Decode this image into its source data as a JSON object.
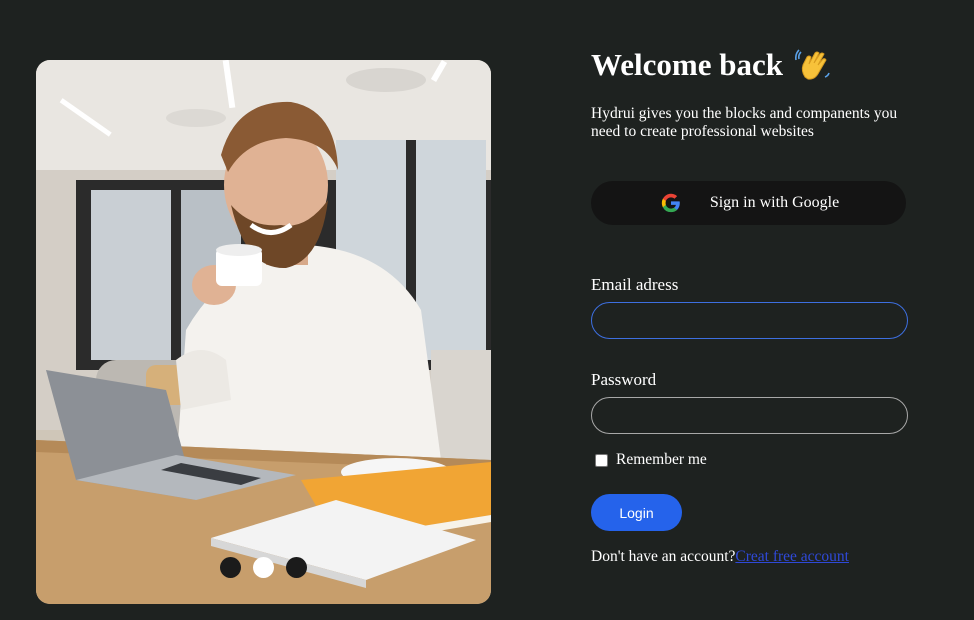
{
  "login": {
    "title": "Welcome back",
    "title_emoji_icon": "waving-hand-icon",
    "subtitle": "Hydrui gives you the blocks and companents you need to create professional websites",
    "google_button": {
      "label": "Sign in with Google",
      "icon": "google-logo-icon"
    },
    "email": {
      "label": "Email adress",
      "value": "",
      "placeholder": ""
    },
    "password": {
      "label": "Password",
      "value": "",
      "placeholder": ""
    },
    "remember_label": "Remember me",
    "remember_checked": false,
    "login_label": "Login",
    "signup_prompt": "Don't have an account?",
    "signup_link": "Creat free account"
  },
  "carousel": {
    "slide_count": 3,
    "active_index": 1
  },
  "colors": {
    "background": "#1e2220",
    "button_dark": "#141414",
    "accent_blue": "#2563eb",
    "focus_border": "#3d6fe0",
    "link": "#2f49d8"
  }
}
